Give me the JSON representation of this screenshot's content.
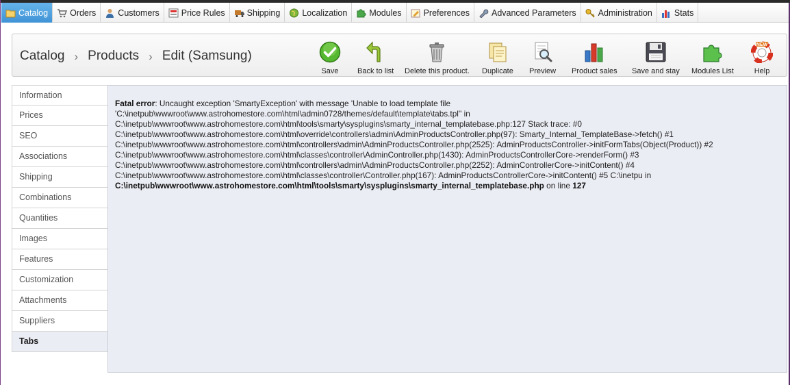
{
  "menu": [
    {
      "label": "Catalog",
      "icon": "catalog-folder-icon",
      "active": true
    },
    {
      "label": "Orders",
      "icon": "cart-icon"
    },
    {
      "label": "Customers",
      "icon": "customer-icon"
    },
    {
      "label": "Price Rules",
      "icon": "price-rules-icon"
    },
    {
      "label": "Shipping",
      "icon": "truck-icon"
    },
    {
      "label": "Localization",
      "icon": "globe-icon"
    },
    {
      "label": "Modules",
      "icon": "puzzle-icon"
    },
    {
      "label": "Preferences",
      "icon": "preferences-icon"
    },
    {
      "label": "Advanced Parameters",
      "icon": "wrench-icon"
    },
    {
      "label": "Administration",
      "icon": "key-icon"
    },
    {
      "label": "Stats",
      "icon": "stats-icon"
    }
  ],
  "breadcrumb": {
    "level1": "Catalog",
    "level2": "Products",
    "level3": "Edit (Samsung)",
    "separator": "›"
  },
  "toolbar": {
    "save": "Save",
    "back": "Back to list",
    "delete": "Delete this product.",
    "duplicate": "Duplicate",
    "preview": "Preview",
    "sales": "Product sales",
    "save_stay": "Save and stay",
    "modules_list": "Modules List",
    "help": "Help",
    "help_badge": "NEW"
  },
  "tabs": [
    {
      "label": "Information"
    },
    {
      "label": "Prices"
    },
    {
      "label": "SEO"
    },
    {
      "label": "Associations"
    },
    {
      "label": "Shipping"
    },
    {
      "label": "Combinations"
    },
    {
      "label": "Quantities"
    },
    {
      "label": "Images"
    },
    {
      "label": "Features"
    },
    {
      "label": "Customization"
    },
    {
      "label": "Attachments"
    },
    {
      "label": "Suppliers"
    },
    {
      "label": "Tabs",
      "active": true
    }
  ],
  "error": {
    "label": "Fatal error",
    "line1": ": Uncaught exception 'SmartyException' with message 'Unable to load template file",
    "line2": "'C:\\inetpub\\wwwroot\\www.astrohomestore.com\\html\\admin0728/themes/default\\template\\tabs.tpl'' in",
    "line3": "C:\\inetpub\\wwwroot\\www.astrohomestore.com\\html\\tools\\smarty\\sysplugins\\smarty_internal_templatebase.php:127 Stack trace: #0",
    "line4": "C:\\inetpub\\wwwroot\\www.astrohomestore.com\\html\\override\\controllers\\admin\\AdminProductsController.php(97): Smarty_Internal_TemplateBase->fetch() #1",
    "line5": "C:\\inetpub\\wwwroot\\www.astrohomestore.com\\html\\controllers\\admin\\AdminProductsController.php(2525): AdminProductsController->initFormTabs(Object(Product)) #2",
    "line6": "C:\\inetpub\\wwwroot\\www.astrohomestore.com\\html\\classes\\controller\\AdminController.php(1430): AdminProductsControllerCore->renderForm() #3",
    "line7": "C:\\inetpub\\wwwroot\\www.astrohomestore.com\\html\\controllers\\admin\\AdminProductsController.php(2252): AdminControllerCore->initContent() #4",
    "line8": "C:\\inetpub\\wwwroot\\www.astrohomestore.com\\html\\classes\\controller\\Controller.php(167): AdminProductsControllerCore->initContent() #5 C:\\inetpu in",
    "file": "C:\\inetpub\\wwwroot\\www.astrohomestore.com\\html\\tools\\smarty\\sysplugins\\smarty_internal_templatebase.php",
    "on_line": " on line ",
    "line_no": "127"
  }
}
